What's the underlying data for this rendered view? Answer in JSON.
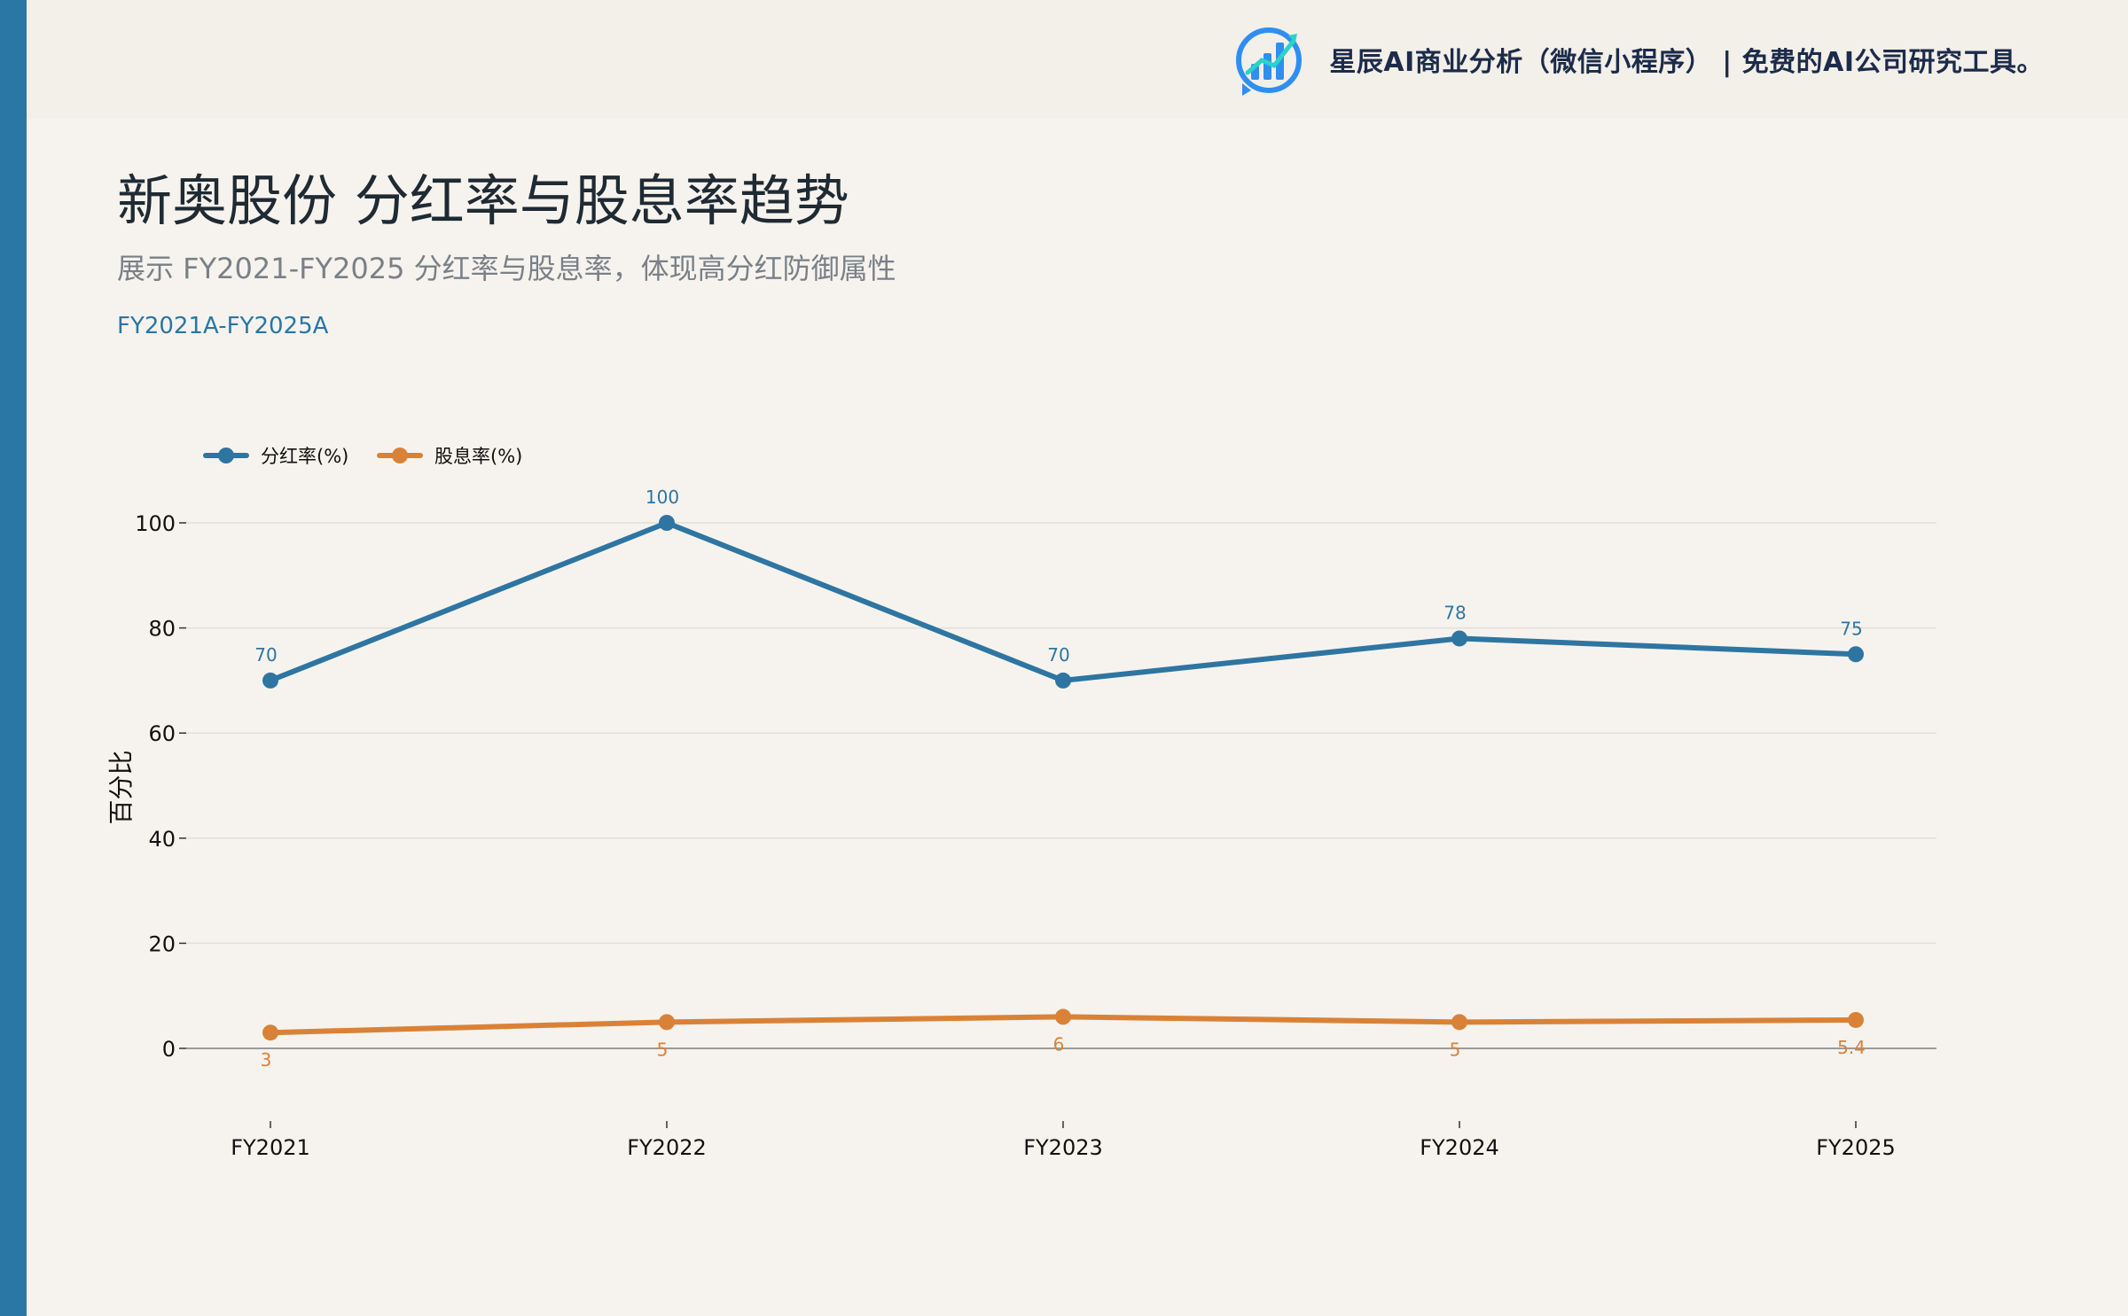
{
  "header": {
    "brand_text": "星辰AI商业分析（微信小程序）  |  免费的AI公司研究工具。",
    "logo_icon": "bar-chart-growth-icon"
  },
  "title": "新奥股份 分红率与股息率趋势",
  "subtitle": "展示 FY2021-FY2025 分红率与股息率，体现高分红防御属性",
  "range_tag": "FY2021A-FY2025A",
  "colors": {
    "accent": "#2a76a4",
    "series_payout": "#2e75a2",
    "series_yield": "#d98237",
    "background": "#f6f3ee"
  },
  "chart_data": {
    "type": "line",
    "categories": [
      "FY2021",
      "FY2022",
      "FY2023",
      "FY2024",
      "FY2025"
    ],
    "series": [
      {
        "name": "分红率(%)",
        "values": [
          70,
          100,
          70,
          78,
          75
        ],
        "labels": [
          "70",
          "100",
          "70",
          "78",
          "75"
        ],
        "color": "#2e75a2"
      },
      {
        "name": "股息率(%)",
        "values": [
          3,
          5,
          6,
          5,
          5.4
        ],
        "labels": [
          "3",
          "5",
          "6",
          "5",
          "5.4"
        ],
        "color": "#d98237"
      }
    ],
    "ylabel": "百分比",
    "xlabel": "",
    "ylim": [
      0,
      100
    ],
    "yticks": [
      0,
      20,
      40,
      60,
      80,
      100
    ],
    "grid": true,
    "legend_position": "top-left"
  }
}
